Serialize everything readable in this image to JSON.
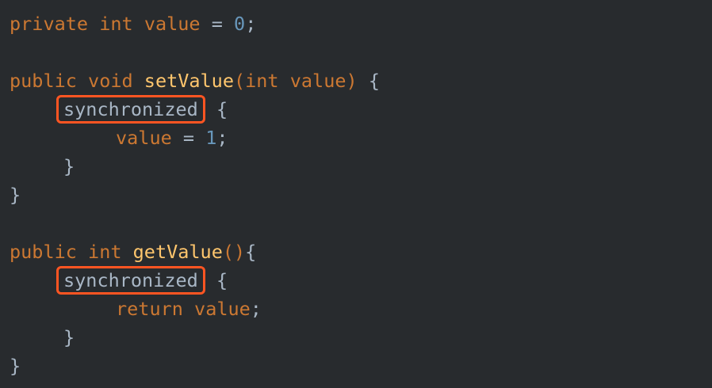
{
  "code": {
    "lines": [
      {
        "tokens": [
          "private",
          "int",
          "value",
          "=",
          "0",
          ";"
        ]
      },
      {
        "tokens": []
      },
      {
        "tokens": [
          "public",
          "void",
          "setValue",
          "(",
          "int",
          "value",
          ")",
          "{"
        ]
      },
      {
        "tokens": [
          "synchronized",
          "{"
        ]
      },
      {
        "tokens": [
          "value",
          "=",
          "1",
          ";"
        ]
      },
      {
        "tokens": [
          "}"
        ]
      },
      {
        "tokens": [
          "}"
        ]
      },
      {
        "tokens": []
      },
      {
        "tokens": [
          "public",
          "int",
          "getValue",
          "()",
          "{"
        ]
      },
      {
        "tokens": [
          "synchronized",
          "{"
        ]
      },
      {
        "tokens": [
          "return",
          "value",
          ";"
        ]
      },
      {
        "tokens": [
          "}"
        ]
      },
      {
        "tokens": [
          "}"
        ]
      }
    ]
  },
  "colors": {
    "background": "#282b2e",
    "keyword": "#cc7832",
    "function": "#ffc66d",
    "number": "#6897bb",
    "plain": "#a9b7c6",
    "highlight_box": "#ff5522"
  }
}
